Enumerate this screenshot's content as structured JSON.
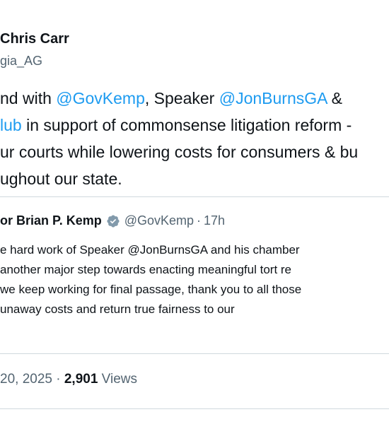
{
  "tweet": {
    "author_name": "Chris Carr",
    "author_handle": "gia_AG",
    "body_lines": [
      [
        {
          "t": "nd with "
        },
        {
          "t": "@GovKemp",
          "m": true
        },
        {
          "t": ", Speaker "
        },
        {
          "t": "@JonBurnsGA",
          "m": true
        },
        {
          "t": " &"
        }
      ],
      [
        {
          "t": "lub",
          "m": true
        },
        {
          "t": " in support of commonsense litigation reform -"
        }
      ],
      [
        {
          "t": "ur courts while lowering costs for consumers & bu"
        }
      ],
      [
        {
          "t": "ughout our state."
        }
      ]
    ]
  },
  "quote": {
    "author_name": "or Brian P. Kemp",
    "handle": "@GovKemp",
    "separator": "·",
    "time": "17h",
    "lines": [
      "e hard work of Speaker @JonBurnsGA and his chamber",
      "another major step towards enacting meaningful tort re",
      "we keep working for final passage, thank you to all those",
      "unaway costs and return true fairness to our"
    ]
  },
  "meta": {
    "date": "20, 2025 · ",
    "views_count": "2,901",
    "views_label": " Views"
  },
  "colors": {
    "mention": "#1d9bf0",
    "secondary_text": "#536471",
    "verified_badge": "#829aab",
    "divider": "#cfd9de"
  },
  "icons": {
    "verified": "verified-badge-icon"
  }
}
